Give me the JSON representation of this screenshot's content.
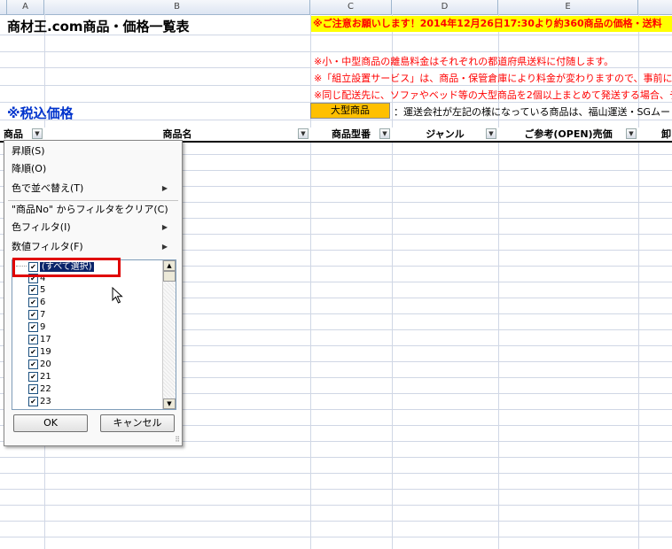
{
  "column_headers": [
    "A",
    "B",
    "C",
    "D",
    "E"
  ],
  "sheet": {
    "title": "商材王.com商品・価格一覧表",
    "notice": "※ご注意お願いします！2014年12月26日17:30より約360商品の価格・送料",
    "notes": [
      "※小・中型商品の離島料金はそれぞれの都道府県送料に付随します。",
      "※「組立設置サービス」は、商品・保管倉庫により料金が変わりますので、事前にお見",
      "※同じ配送先に、ソファやベッド等の大型商品を2個以上まとめて発送する場合、チャ"
    ],
    "tax_label": "※税込価格",
    "large_item_badge": "大型商品",
    "large_item_desc": "：運送会社が左記の様になっている商品は、福山運送・SGムービ",
    "table_headers": [
      "商品No",
      "商品名",
      "商品型番",
      "ジャンル",
      "ご参考(OPEN)売価",
      "卸"
    ]
  },
  "filter_menu": {
    "sort_asc": "昇順(S)",
    "sort_desc": "降順(O)",
    "sort_by_color": "色で並べ替え(T)",
    "clear_filter": "\"商品No\" からフィルタをクリア(C)",
    "color_filter": "色フィルタ(I)",
    "number_filter": "数値フィルタ(F)",
    "select_all": "(すべて選択)",
    "items": [
      "4",
      "5",
      "6",
      "7",
      "9",
      "17",
      "19",
      "20",
      "21",
      "22",
      "23"
    ],
    "ok_label": "OK",
    "cancel_label": "キャンセル"
  }
}
